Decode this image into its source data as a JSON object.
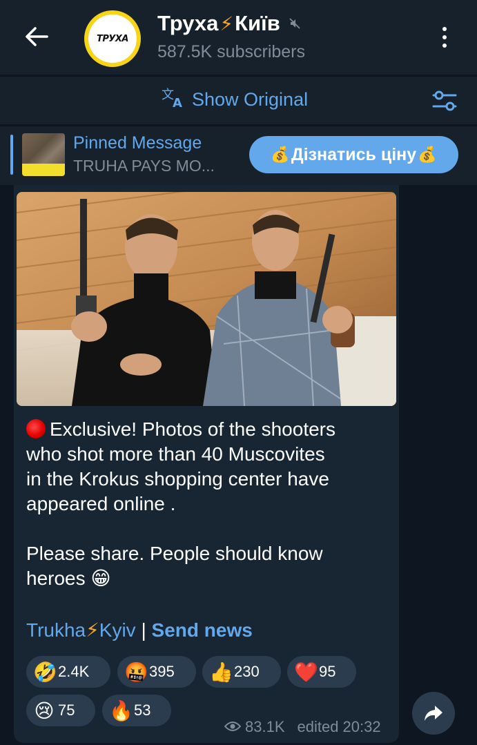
{
  "header": {
    "channel_name_part1": "Труха",
    "channel_name_bolt": "⚡",
    "channel_name_part2": "Київ",
    "subscribers": "587.5K subscribers",
    "avatar_text": "ТРУХА"
  },
  "translate": {
    "label": "Show Original"
  },
  "pinned": {
    "title": "Pinned Message",
    "preview": "TRUHA PAYS MO...",
    "button_label": "Дізнатись ціну",
    "button_emoji": "💰"
  },
  "message": {
    "line1": "Exclusive! Photos of the shooters",
    "line2": "who shot more than 40 Muscovites",
    "line3": "in the Krokus shopping center have",
    "line4": "appeared online .",
    "line5": "Please share. People should know",
    "line6": "heroes",
    "emoji_end": "😁",
    "link1_part1": "Trukha",
    "link1_bolt": "⚡",
    "link1_part2": "Kyiv",
    "link_separator": " | ",
    "link2": "Send news"
  },
  "reactions": [
    {
      "emoji": "🤣",
      "count": "2.4K"
    },
    {
      "emoji": "🤬",
      "count": "395"
    },
    {
      "emoji": "👍",
      "count": "230"
    },
    {
      "emoji": "❤️",
      "count": "95"
    },
    {
      "emoji": "😢",
      "count": "75"
    },
    {
      "emoji": "🔥",
      "count": "53"
    }
  ],
  "meta": {
    "views": "83.1K",
    "edited": "edited 20:32"
  },
  "colors": {
    "background": "#0e1621",
    "panel": "#17212b",
    "bubble": "#182533",
    "accent": "#62a8ea",
    "reaction_bg": "#2b3c4f",
    "avatar_ring": "#f7d417"
  },
  "icons": [
    "back-arrow-icon",
    "muted-icon",
    "more-vertical-icon",
    "translate-icon",
    "settings-sliders-icon",
    "eye-icon",
    "share-icon"
  ]
}
